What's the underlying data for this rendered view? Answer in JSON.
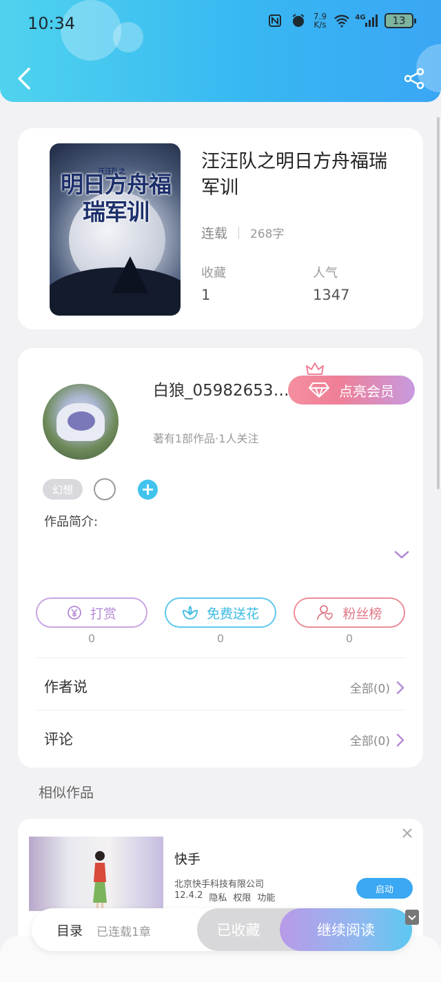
{
  "status_bar": {
    "time": "10:34",
    "net_speed_value": "7.9",
    "net_speed_unit": "K/s",
    "signal_label": "4G",
    "battery": "13"
  },
  "book": {
    "cover_small": "汪汪队之",
    "cover_title": "明日方舟福瑞军训",
    "title": "汪汪队之明日方舟福瑞军训",
    "status": "连载",
    "word_count": "268字",
    "favorites_label": "收藏",
    "favorites_value": "1",
    "popularity_label": "人气",
    "popularity_value": "1347"
  },
  "author": {
    "name": "白狼_059826533...",
    "works": "著有1部作品·1人关注",
    "vip_button": "点亮会员",
    "tag": "幻想",
    "intro_label": "作品简介:"
  },
  "actions": [
    {
      "label": "打赏",
      "count": "0",
      "color": "#c9a3e3",
      "text_color": "#b58ad6"
    },
    {
      "label": "免费送花",
      "count": "0",
      "color": "#5cc9ea",
      "text_color": "#3bbbe3"
    },
    {
      "label": "粉丝榜",
      "count": "0",
      "color": "#ec8d98",
      "text_color": "#e07786"
    }
  ],
  "rows": {
    "author_says": "作者说",
    "author_says_right": "全部(0)",
    "comments": "评论",
    "comments_right": "全部(0)"
  },
  "similar": {
    "label": "相似作品"
  },
  "ad": {
    "title": "快手",
    "company": "北京快手科技有限公司",
    "version": "12.4.2",
    "privacy": "隐私",
    "permissions": "权限",
    "features": "功能",
    "launch": "启动"
  },
  "bottom": {
    "toc": "目录",
    "toc_status": "已连载1章",
    "favorited": "已收藏",
    "continue": "继续阅读"
  },
  "colors": {
    "header_start": "#4fd3ee",
    "header_end": "#3aa6f4",
    "accent_purple": "#b58ad6",
    "accent_cyan": "#3bbbe3",
    "accent_pink": "#e07786"
  }
}
